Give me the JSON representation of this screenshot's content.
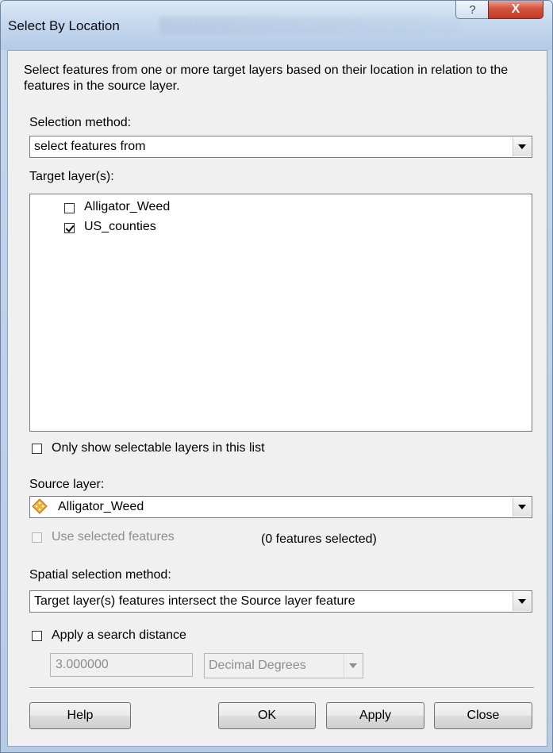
{
  "window": {
    "title": "Select By Location",
    "help_glyph": "?",
    "close_glyph": "X"
  },
  "description": "Select features from one or more target layers based on their location in relation to the features in the source layer.",
  "selection_method": {
    "label": "Selection method:",
    "value": "select features from"
  },
  "target_layers": {
    "label": "Target layer(s):",
    "items": [
      {
        "label": "Alligator_Weed",
        "checked": false
      },
      {
        "label": "US_counties",
        "checked": true
      }
    ]
  },
  "only_selectable": {
    "label": "Only show selectable layers in this list",
    "checked": false
  },
  "source_layer": {
    "label": "Source layer:",
    "value": "Alligator_Weed",
    "icon": "point-layer-icon",
    "icon_color": "#e8a623"
  },
  "use_selected": {
    "label": "Use selected features",
    "checked": false,
    "enabled": false,
    "count_text": "(0 features selected)"
  },
  "spatial_method": {
    "label": "Spatial selection method:",
    "value": "Target layer(s) features intersect the Source layer feature"
  },
  "search_distance": {
    "label": "Apply a search distance",
    "checked": false,
    "value": "3.000000",
    "units": "Decimal Degrees"
  },
  "buttons": {
    "help": "Help",
    "ok": "OK",
    "apply": "Apply",
    "close": "Close"
  }
}
